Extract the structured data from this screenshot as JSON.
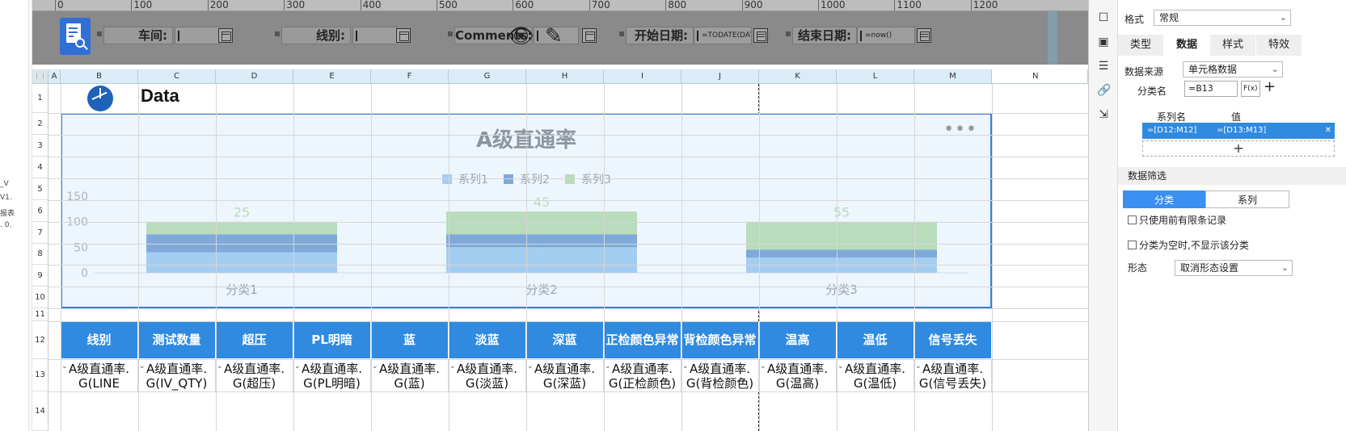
{
  "left_sliver": {
    "labels": [
      "_V",
      "V1.",
      "报表",
      ". 0."
    ]
  },
  "ruler": {
    "ticks": [
      "0",
      "100",
      "200",
      "300",
      "400",
      "500",
      "600",
      "700",
      "800",
      "900",
      "1000",
      "1100",
      "1200"
    ]
  },
  "params": {
    "workshop_label": "车间:",
    "line_label": "线别:",
    "comments_label": "Comments:",
    "start_label": "开始日期:",
    "start_value": "=TODATE(DATE",
    "end_label": "结束日期:",
    "end_value": "=now()"
  },
  "grid": {
    "columns": [
      "A",
      "B",
      "C",
      "D",
      "E",
      "F",
      "G",
      "H",
      "I",
      "J",
      "K",
      "L",
      "M",
      "N"
    ],
    "rows": [
      "1",
      "2",
      "3",
      "4",
      "5",
      "6",
      "7",
      "8",
      "9",
      "10",
      "11",
      "12",
      "13",
      "14"
    ],
    "title": "Data"
  },
  "chart_data": {
    "type": "bar",
    "stacked": true,
    "title": "A级直通率",
    "categories": [
      "分类1",
      "分类2",
      "分类3"
    ],
    "series": [
      {
        "name": "系列1",
        "values": [
          40,
          50,
          30
        ],
        "color": "#a4cdf2"
      },
      {
        "name": "系列2",
        "values": [
          35,
          25,
          15
        ],
        "color": "#7fa9d9"
      },
      {
        "name": "系列3",
        "values": [
          25,
          45,
          55
        ],
        "color": "#b8dcbc"
      }
    ],
    "yticks": [
      "0",
      "50",
      "100",
      "150"
    ],
    "ylim": [
      0,
      150
    ],
    "legend": "top",
    "grid": false
  },
  "table": {
    "headers": [
      "线别",
      "测试数量",
      "超压",
      "PL明暗",
      "蓝",
      "淡蓝",
      "深蓝",
      "正检颜色异常",
      "背检颜色异常",
      "温高",
      "温低",
      "信号丢失"
    ],
    "cells": [
      [
        "A级直通率.",
        "G(LINE"
      ],
      [
        "A级直通率.",
        "G(IV_QTY)"
      ],
      [
        "A级直通率.",
        "G(超压)"
      ],
      [
        "A级直通率.",
        "G(PL明暗)"
      ],
      [
        "A级直通率.",
        "G(蓝)"
      ],
      [
        "A级直通率.",
        "G(淡蓝)"
      ],
      [
        "A级直通率.",
        "G(深蓝)"
      ],
      [
        "A级直通率.",
        "G(正检颜色)"
      ],
      [
        "A级直通率.",
        "G(背检颜色)"
      ],
      [
        "A级直通率.",
        "G(温高)"
      ],
      [
        "A级直通率.",
        "G(温低)"
      ],
      [
        "A级直通率.",
        "G(信号丢失)"
      ]
    ]
  },
  "panel": {
    "format_label": "格式",
    "format_value": "常规",
    "tabs": [
      "类型",
      "数据",
      "样式",
      "特效"
    ],
    "active_tab": "数据",
    "source_label": "数据来源",
    "source_value": "单元格数据",
    "category_label": "分类名",
    "category_value": "=B13",
    "fx_label": "F(x)",
    "add": "+",
    "series_name_head": "系列名",
    "value_head": "值",
    "series_name_value": "=[D12:M12]",
    "value_value": "=[D13:M13]",
    "remove": "✕",
    "filter_title": "数据筛选",
    "toggle_category": "分类",
    "toggle_series": "系列",
    "check1": "只使用前有限条记录",
    "check2": "分类为空时,不显示该分类",
    "form_label": "形态",
    "form_value": "取消形态设置"
  }
}
